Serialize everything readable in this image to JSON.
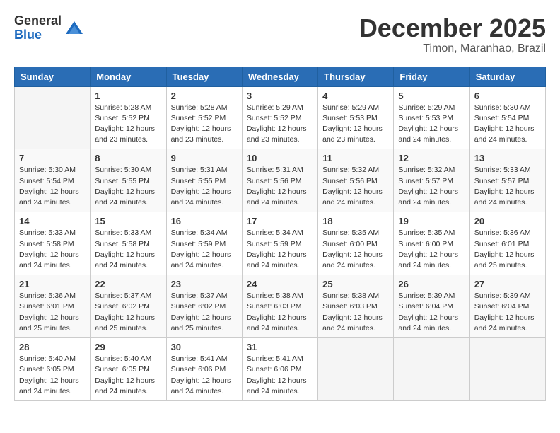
{
  "logo": {
    "general": "General",
    "blue": "Blue"
  },
  "header": {
    "month": "December 2025",
    "location": "Timon, Maranhao, Brazil"
  },
  "weekdays": [
    "Sunday",
    "Monday",
    "Tuesday",
    "Wednesday",
    "Thursday",
    "Friday",
    "Saturday"
  ],
  "weeks": [
    [
      {
        "day": "",
        "info": ""
      },
      {
        "day": "1",
        "info": "Sunrise: 5:28 AM\nSunset: 5:52 PM\nDaylight: 12 hours\nand 23 minutes."
      },
      {
        "day": "2",
        "info": "Sunrise: 5:28 AM\nSunset: 5:52 PM\nDaylight: 12 hours\nand 23 minutes."
      },
      {
        "day": "3",
        "info": "Sunrise: 5:29 AM\nSunset: 5:52 PM\nDaylight: 12 hours\nand 23 minutes."
      },
      {
        "day": "4",
        "info": "Sunrise: 5:29 AM\nSunset: 5:53 PM\nDaylight: 12 hours\nand 23 minutes."
      },
      {
        "day": "5",
        "info": "Sunrise: 5:29 AM\nSunset: 5:53 PM\nDaylight: 12 hours\nand 24 minutes."
      },
      {
        "day": "6",
        "info": "Sunrise: 5:30 AM\nSunset: 5:54 PM\nDaylight: 12 hours\nand 24 minutes."
      }
    ],
    [
      {
        "day": "7",
        "info": "Sunrise: 5:30 AM\nSunset: 5:54 PM\nDaylight: 12 hours\nand 24 minutes."
      },
      {
        "day": "8",
        "info": "Sunrise: 5:30 AM\nSunset: 5:55 PM\nDaylight: 12 hours\nand 24 minutes."
      },
      {
        "day": "9",
        "info": "Sunrise: 5:31 AM\nSunset: 5:55 PM\nDaylight: 12 hours\nand 24 minutes."
      },
      {
        "day": "10",
        "info": "Sunrise: 5:31 AM\nSunset: 5:56 PM\nDaylight: 12 hours\nand 24 minutes."
      },
      {
        "day": "11",
        "info": "Sunrise: 5:32 AM\nSunset: 5:56 PM\nDaylight: 12 hours\nand 24 minutes."
      },
      {
        "day": "12",
        "info": "Sunrise: 5:32 AM\nSunset: 5:57 PM\nDaylight: 12 hours\nand 24 minutes."
      },
      {
        "day": "13",
        "info": "Sunrise: 5:33 AM\nSunset: 5:57 PM\nDaylight: 12 hours\nand 24 minutes."
      }
    ],
    [
      {
        "day": "14",
        "info": "Sunrise: 5:33 AM\nSunset: 5:58 PM\nDaylight: 12 hours\nand 24 minutes."
      },
      {
        "day": "15",
        "info": "Sunrise: 5:33 AM\nSunset: 5:58 PM\nDaylight: 12 hours\nand 24 minutes."
      },
      {
        "day": "16",
        "info": "Sunrise: 5:34 AM\nSunset: 5:59 PM\nDaylight: 12 hours\nand 24 minutes."
      },
      {
        "day": "17",
        "info": "Sunrise: 5:34 AM\nSunset: 5:59 PM\nDaylight: 12 hours\nand 24 minutes."
      },
      {
        "day": "18",
        "info": "Sunrise: 5:35 AM\nSunset: 6:00 PM\nDaylight: 12 hours\nand 24 minutes."
      },
      {
        "day": "19",
        "info": "Sunrise: 5:35 AM\nSunset: 6:00 PM\nDaylight: 12 hours\nand 24 minutes."
      },
      {
        "day": "20",
        "info": "Sunrise: 5:36 AM\nSunset: 6:01 PM\nDaylight: 12 hours\nand 25 minutes."
      }
    ],
    [
      {
        "day": "21",
        "info": "Sunrise: 5:36 AM\nSunset: 6:01 PM\nDaylight: 12 hours\nand 25 minutes."
      },
      {
        "day": "22",
        "info": "Sunrise: 5:37 AM\nSunset: 6:02 PM\nDaylight: 12 hours\nand 25 minutes."
      },
      {
        "day": "23",
        "info": "Sunrise: 5:37 AM\nSunset: 6:02 PM\nDaylight: 12 hours\nand 25 minutes."
      },
      {
        "day": "24",
        "info": "Sunrise: 5:38 AM\nSunset: 6:03 PM\nDaylight: 12 hours\nand 24 minutes."
      },
      {
        "day": "25",
        "info": "Sunrise: 5:38 AM\nSunset: 6:03 PM\nDaylight: 12 hours\nand 24 minutes."
      },
      {
        "day": "26",
        "info": "Sunrise: 5:39 AM\nSunset: 6:04 PM\nDaylight: 12 hours\nand 24 minutes."
      },
      {
        "day": "27",
        "info": "Sunrise: 5:39 AM\nSunset: 6:04 PM\nDaylight: 12 hours\nand 24 minutes."
      }
    ],
    [
      {
        "day": "28",
        "info": "Sunrise: 5:40 AM\nSunset: 6:05 PM\nDaylight: 12 hours\nand 24 minutes."
      },
      {
        "day": "29",
        "info": "Sunrise: 5:40 AM\nSunset: 6:05 PM\nDaylight: 12 hours\nand 24 minutes."
      },
      {
        "day": "30",
        "info": "Sunrise: 5:41 AM\nSunset: 6:06 PM\nDaylight: 12 hours\nand 24 minutes."
      },
      {
        "day": "31",
        "info": "Sunrise: 5:41 AM\nSunset: 6:06 PM\nDaylight: 12 hours\nand 24 minutes."
      },
      {
        "day": "",
        "info": ""
      },
      {
        "day": "",
        "info": ""
      },
      {
        "day": "",
        "info": ""
      }
    ]
  ]
}
